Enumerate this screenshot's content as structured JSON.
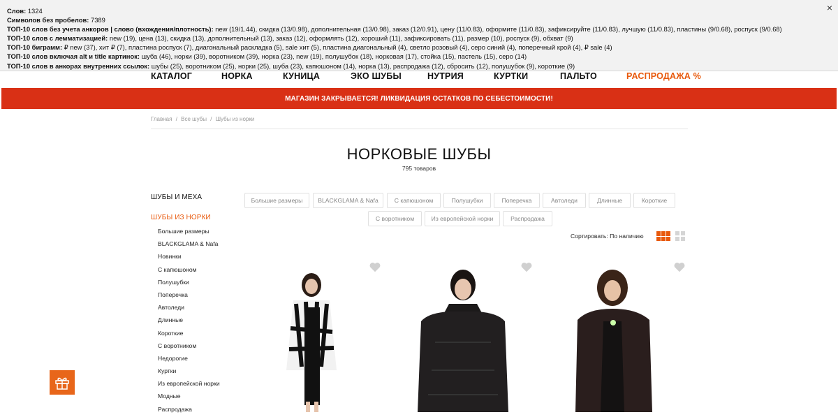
{
  "seo": {
    "rows": [
      {
        "label": "Слов:",
        "text": " 1324"
      },
      {
        "label": "Символов без пробелов:",
        "text": " 7389"
      },
      {
        "label": "ТОП-10 слов без учета анкоров | слово (вхождения/плотность):",
        "text": " new (19/1.44), скидка (13/0.98), дополнительная (13/0.98), заказ (12/0.91), цену (11/0.83), оформите (11/0.83), зафиксируйте (11/0.83), лучшую (11/0.83), пластины (9/0.68), роспуск (9/0.68)"
      },
      {
        "label": "ТОП-10 слов с лемматизацией:",
        "text": " new (19), цена (13), скидка (13), дополнительный (13), заказ (12), оформлять (12), хороший (11), зафиксировать (11), размер (10), роспуск (9), обхват (9)"
      },
      {
        "label": "ТОП-10 биграмм:",
        "text": " ₽ new (37), хит ₽ (7), пластина роспуск (7), диагональный раскладка (5), sale хит (5), пластина диагональный (4), светло розовый (4), серо синий (4), поперечный крой (4), ₽ sale (4)"
      },
      {
        "label": "ТОП-10 слов включая alt и title картинок:",
        "text": " шуба (46), норки (39), воротником (39), норка (23), new (19), полушубок (18), норковая (17), стойка (15), пастель (15), серо (14)"
      },
      {
        "label": "ТОП-10 слов в анкорах внутренних ссылок:",
        "text": " шубы (25), воротником (25), норки (25), шуба (23), капюшоном (14), норка (13), распродажа (12), сбросить (12), полушубок (9), короткие (9)"
      }
    ],
    "close": "×"
  },
  "nav": [
    "КАТАЛОГ",
    "НОРКА",
    "КУНИЦА",
    "ЭКО ШУБЫ",
    "НУТРИЯ",
    "КУРТКИ",
    "ПАЛЬТО",
    "РАСПРОДАЖА %"
  ],
  "banner": "МАГАЗИН ЗАКРЫВАЕТСЯ! ЛИКВИДАЦИЯ ОСТАТКОВ ПО СЕБЕСТОИМОСТИ!",
  "breadcrumbs": [
    "Главная",
    "/",
    "Все шубы",
    "/",
    "Шубы из норки"
  ],
  "page_title": "НОРКОВЫЕ ШУБЫ",
  "product_count": "795 товаров",
  "sidebar": {
    "head1": "ШУБЫ И МЕХА",
    "head2": "ШУБЫ ИЗ НОРКИ",
    "items": [
      "Большие размеры",
      "BLACKGLAMA & Nafa",
      "Новинки",
      "С капюшоном",
      "Полушубки",
      "Поперечка",
      "Автоледи",
      "Длинные",
      "Короткие",
      "С воротником",
      "Недорогие",
      "Куртки",
      "Из европейской норки",
      "Модные",
      "Распродажа"
    ]
  },
  "filters": [
    "Большие размеры",
    "BLACKGLAMA & Nafa",
    "С капюшоном",
    "Полушубки",
    "Поперечка",
    "Автоледи",
    "Длинные",
    "Короткие",
    "С воротником",
    "Из европейской норки",
    "Распродажа"
  ],
  "sort_label": "Сортировать: По наличию",
  "colors": {
    "accent": "#e8590c",
    "banner": "#d93015"
  }
}
